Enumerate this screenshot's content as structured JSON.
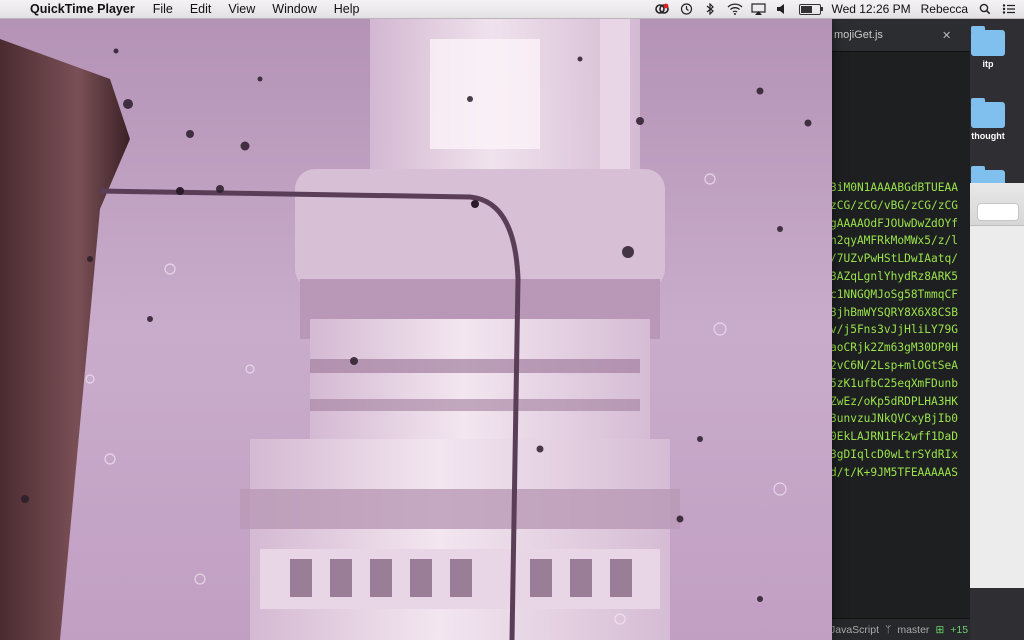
{
  "menubar": {
    "app_name": "QuickTime Player",
    "menus": [
      "File",
      "Edit",
      "View",
      "Window",
      "Help"
    ],
    "clock": "Wed 12:26 PM",
    "user": "Rebecca",
    "battery_level": 0.6
  },
  "editor": {
    "tab_title": "mojiGet.js",
    "code_lines": [
      "3iM0N1AAAABGdBTUEAA",
      "zCG/zCG/vBG/zCG/zCG",
      "gAAAAOdFJOUwDwZdOYf",
      "n2qyAMFRkMoMWx5/z/l",
      "/7UZvPwHStLDwIAatq/",
      "3AZqLgnlYhydRz8ARK5",
      "c1NNGQMJoSg58TmmqCF",
      "3jhBmWYSQRY8X6X8CSB",
      "v/j5Fns3vJjHliLY79G",
      "aoCRjk2Zm63gM30DP0H",
      "2vC6N/2Lsp+mlOGtSeA",
      "5zK1ufbC25eqXmFDunb",
      "ZwEz/oKp5dRDPLHA3HK",
      "3unvzuJNkQVCxyBjIb0",
      "0EkLAJRN1Fk2wff1DaD",
      "3gDIqlcD0wLtrSYdRIx",
      "d/t/K+9JM5TFEAAAAAS"
    ],
    "status_language": "JavaScript",
    "status_branch": "master",
    "status_changes": "+15"
  },
  "desktop": {
    "icons": [
      "itp",
      "thought"
    ]
  },
  "colors": {
    "menubar_bg": "#ececec",
    "code_green": "#9be34a",
    "folder_blue": "#7fc0ee",
    "video_tint": "#c7a9c9"
  }
}
